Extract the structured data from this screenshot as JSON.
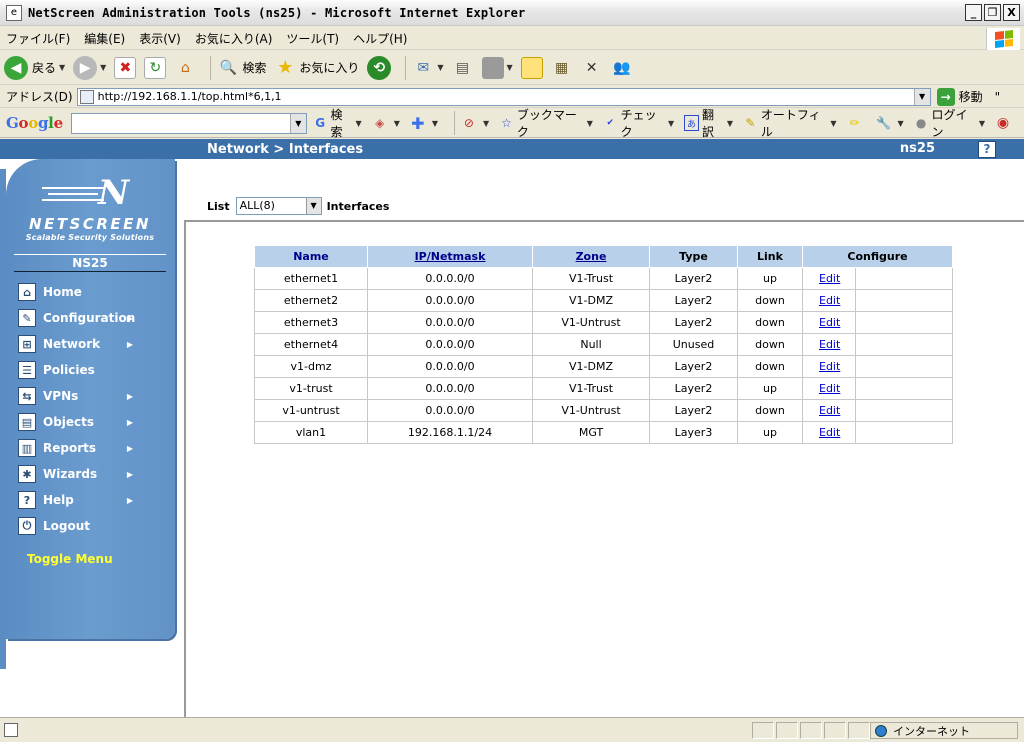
{
  "window": {
    "title": "NetScreen Administration Tools (ns25) - Microsoft Internet Explorer",
    "buttons": [
      "_",
      "❐",
      "X"
    ]
  },
  "menubar": [
    "ファイル(F)",
    "編集(E)",
    "表示(V)",
    "お気に入り(A)",
    "ツール(T)",
    "ヘルプ(H)"
  ],
  "toolbar": {
    "back_label": "戻る",
    "search_label": "検索",
    "favorites_label": "お気に入り"
  },
  "address": {
    "label": "アドレス(D)",
    "url": "http://192.168.1.1/top.html*6,1,1",
    "go_label": "移動",
    "links": "\""
  },
  "google": {
    "logo": "Google",
    "search_label": "検索",
    "bookmark_label": "ブックマーク",
    "check_label": "チェック",
    "translate_label": "翻訳",
    "autofill_label": "オートフィル",
    "login_label": "ログイン"
  },
  "sidebar": {
    "brand": "NETSCREEN",
    "tagline": "Scalable Security Solutions",
    "device": "NS25",
    "items": [
      {
        "label": "Home",
        "icon": "home-icon",
        "submenu": false
      },
      {
        "label": "Configuration",
        "icon": "wrench-icon",
        "submenu": true
      },
      {
        "label": "Network",
        "icon": "network-icon",
        "submenu": true
      },
      {
        "label": "Policies",
        "icon": "policies-icon",
        "submenu": false
      },
      {
        "label": "VPNs",
        "icon": "vpn-icon",
        "submenu": true
      },
      {
        "label": "Objects",
        "icon": "objects-icon",
        "submenu": true
      },
      {
        "label": "Reports",
        "icon": "reports-icon",
        "submenu": true
      },
      {
        "label": "Wizards",
        "icon": "wizard-icon",
        "submenu": true
      },
      {
        "label": "Help",
        "icon": "help-icon",
        "submenu": true
      },
      {
        "label": "Logout",
        "icon": "logout-icon",
        "submenu": false
      }
    ],
    "toggle_menu": "Toggle Menu"
  },
  "main": {
    "breadcrumb": "Network > Interfaces",
    "device_label": "ns25",
    "help": "?",
    "list_label": "List",
    "list_select": "ALL(8)",
    "list_suffix": "Interfaces",
    "columns": [
      "Name",
      "IP/Netmask",
      "Zone",
      "Type",
      "Link",
      "Configure"
    ],
    "rows": [
      {
        "name": "ethernet1",
        "ip": "0.0.0.0/0",
        "zone": "V1-Trust",
        "type": "Layer2",
        "link": "up",
        "action": "Edit"
      },
      {
        "name": "ethernet2",
        "ip": "0.0.0.0/0",
        "zone": "V1-DMZ",
        "type": "Layer2",
        "link": "down",
        "action": "Edit"
      },
      {
        "name": "ethernet3",
        "ip": "0.0.0.0/0",
        "zone": "V1-Untrust",
        "type": "Layer2",
        "link": "down",
        "action": "Edit"
      },
      {
        "name": "ethernet4",
        "ip": "0.0.0.0/0",
        "zone": "Null",
        "type": "Unused",
        "link": "down",
        "action": "Edit"
      },
      {
        "name": "v1-dmz",
        "ip": "0.0.0.0/0",
        "zone": "V1-DMZ",
        "type": "Layer2",
        "link": "down",
        "action": "Edit"
      },
      {
        "name": "v1-trust",
        "ip": "0.0.0.0/0",
        "zone": "V1-Trust",
        "type": "Layer2",
        "link": "up",
        "action": "Edit"
      },
      {
        "name": "v1-untrust",
        "ip": "0.0.0.0/0",
        "zone": "V1-Untrust",
        "type": "Layer2",
        "link": "down",
        "action": "Edit"
      },
      {
        "name": "vlan1",
        "ip": "192.168.1.1/24",
        "zone": "MGT",
        "type": "Layer3",
        "link": "up",
        "action": "Edit"
      }
    ]
  },
  "statusbar": {
    "zone": "インターネット"
  },
  "colors": {
    "nav_blue": "#3a6fa8",
    "sidebar_blue": "#6a9ccf",
    "table_header": "#b8d0ea",
    "toggle_yellow": "#ffff33"
  }
}
